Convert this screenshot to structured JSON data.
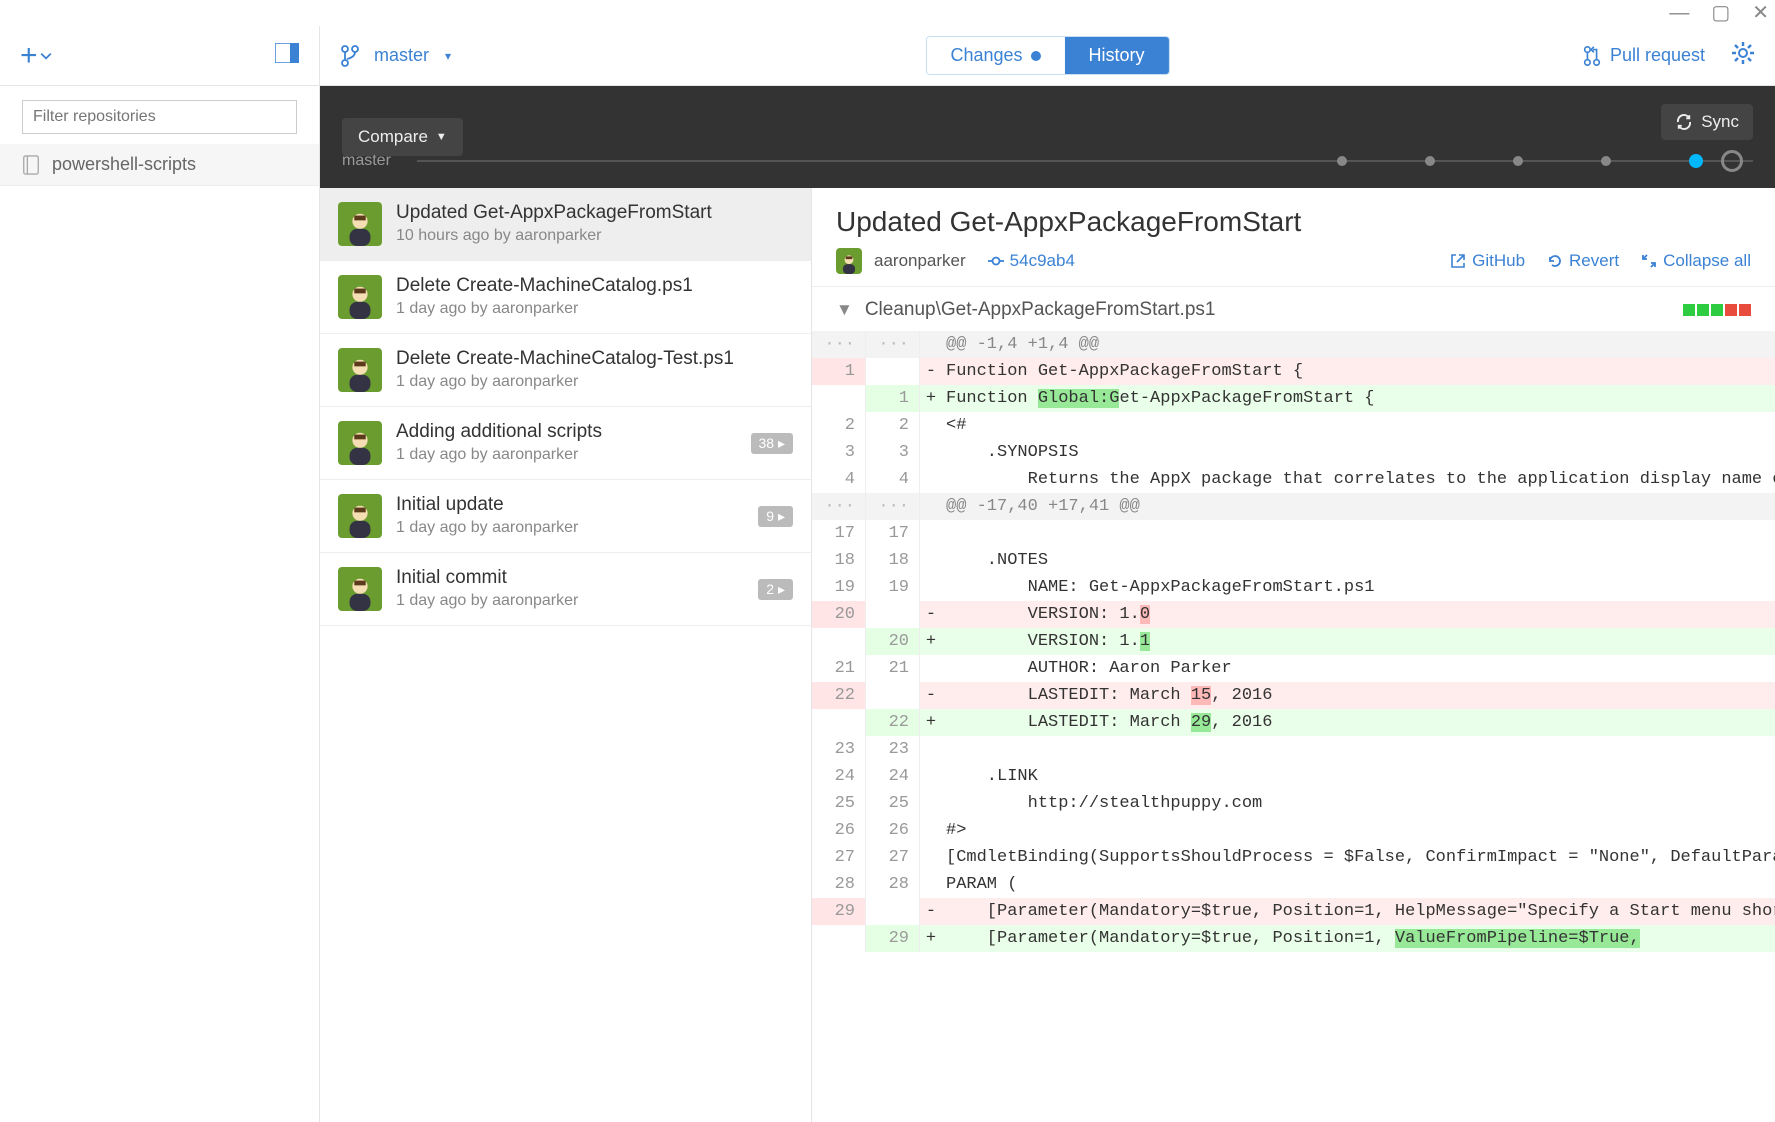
{
  "window": {
    "min": "—",
    "max": "▢",
    "close": "✕"
  },
  "sidebar": {
    "filter_placeholder": "Filter repositories",
    "repos": [
      {
        "name": "powershell-scripts"
      }
    ]
  },
  "topbar": {
    "branch": "master",
    "tabs": {
      "changes": "Changes",
      "history": "History"
    },
    "pull_request": "Pull request"
  },
  "compare": {
    "button": "Compare",
    "sync": "Sync",
    "timeline_label": "master"
  },
  "commits": [
    {
      "title": "Updated Get-AppxPackageFromStart",
      "meta": "10 hours ago by aaronparker",
      "selected": true
    },
    {
      "title": "Delete Create-MachineCatalog.ps1",
      "meta": "1 day ago by aaronparker"
    },
    {
      "title": "Delete Create-MachineCatalog-Test.ps1",
      "meta": "1 day ago by aaronparker"
    },
    {
      "title": "Adding additional scripts",
      "meta": "1 day ago by aaronparker",
      "badge": "38 ▸"
    },
    {
      "title": "Initial update",
      "meta": "1 day ago by aaronparker",
      "badge": "9 ▸"
    },
    {
      "title": "Initial commit",
      "meta": "1 day ago by aaronparker",
      "badge": "2 ▸"
    }
  ],
  "detail": {
    "title": "Updated Get-AppxPackageFromStart",
    "author": "aaronparker",
    "sha": "54c9ab4",
    "actions": {
      "github": "GitHub",
      "revert": "Revert",
      "collapse": "Collapse all"
    },
    "file": "Cleanup\\Get-AppxPackageFromStart.ps1"
  },
  "diff": [
    {
      "type": "hunk",
      "old": "···",
      "new": "···",
      "text": "@@ -1,4 +1,4 @@"
    },
    {
      "type": "del",
      "old": "1",
      "new": "",
      "pre": "Function ",
      "hl": "",
      "post": "Get-AppxPackageFromStart {"
    },
    {
      "type": "add",
      "old": "",
      "new": "1",
      "pre": "Function ",
      "hl": "Global:G",
      "post": "et-AppxPackageFromStart {"
    },
    {
      "type": "ctx",
      "old": "2",
      "new": "2",
      "text": "<#"
    },
    {
      "type": "ctx",
      "old": "3",
      "new": "3",
      "text": "    .SYNOPSIS"
    },
    {
      "type": "ctx",
      "old": "4",
      "new": "4",
      "text": "        Returns the AppX package that correlates to the application display name on the Start menu."
    },
    {
      "type": "hunk",
      "old": "···",
      "new": "···",
      "text": "@@ -17,40 +17,41 @@"
    },
    {
      "type": "ctx",
      "old": "17",
      "new": "17",
      "text": ""
    },
    {
      "type": "ctx",
      "old": "18",
      "new": "18",
      "text": "    .NOTES"
    },
    {
      "type": "ctx",
      "old": "19",
      "new": "19",
      "text": "        NAME: Get-AppxPackageFromStart.ps1"
    },
    {
      "type": "del",
      "old": "20",
      "new": "",
      "pre": "        VERSION: 1.",
      "hl": "0",
      "post": ""
    },
    {
      "type": "add",
      "old": "",
      "new": "20",
      "pre": "        VERSION: 1.",
      "hl": "1",
      "post": ""
    },
    {
      "type": "ctx",
      "old": "21",
      "new": "21",
      "text": "        AUTHOR: Aaron Parker"
    },
    {
      "type": "del",
      "old": "22",
      "new": "",
      "pre": "        LASTEDIT: March ",
      "hl": "15",
      "post": ", 2016"
    },
    {
      "type": "add",
      "old": "",
      "new": "22",
      "pre": "        LASTEDIT: March ",
      "hl": "29",
      "post": ", 2016"
    },
    {
      "type": "ctx",
      "old": "23",
      "new": "23",
      "text": ""
    },
    {
      "type": "ctx",
      "old": "24",
      "new": "24",
      "text": "    .LINK"
    },
    {
      "type": "ctx",
      "old": "25",
      "new": "25",
      "text": "        http://stealthpuppy.com"
    },
    {
      "type": "ctx",
      "old": "26",
      "new": "26",
      "text": "#>"
    },
    {
      "type": "ctx",
      "old": "27",
      "new": "27",
      "text": "[CmdletBinding(SupportsShouldProcess = $False, ConfirmImpact = \"None\", DefaultParameterSetName = \"Name\")]"
    },
    {
      "type": "ctx",
      "old": "28",
      "new": "28",
      "text": "PARAM ("
    },
    {
      "type": "del",
      "old": "29",
      "new": "",
      "pre": "    [Parameter(Mandatory=$true, Position=1, HelpMessage=\"Specify a Start menu shortcut name.\")]",
      "hl": "",
      "post": ""
    },
    {
      "type": "add",
      "old": "",
      "new": "29",
      "pre": "    [Parameter(Mandatory=$true, Position=1, ",
      "hl": "ValueFromPipeline=$True,",
      "post": ""
    }
  ]
}
